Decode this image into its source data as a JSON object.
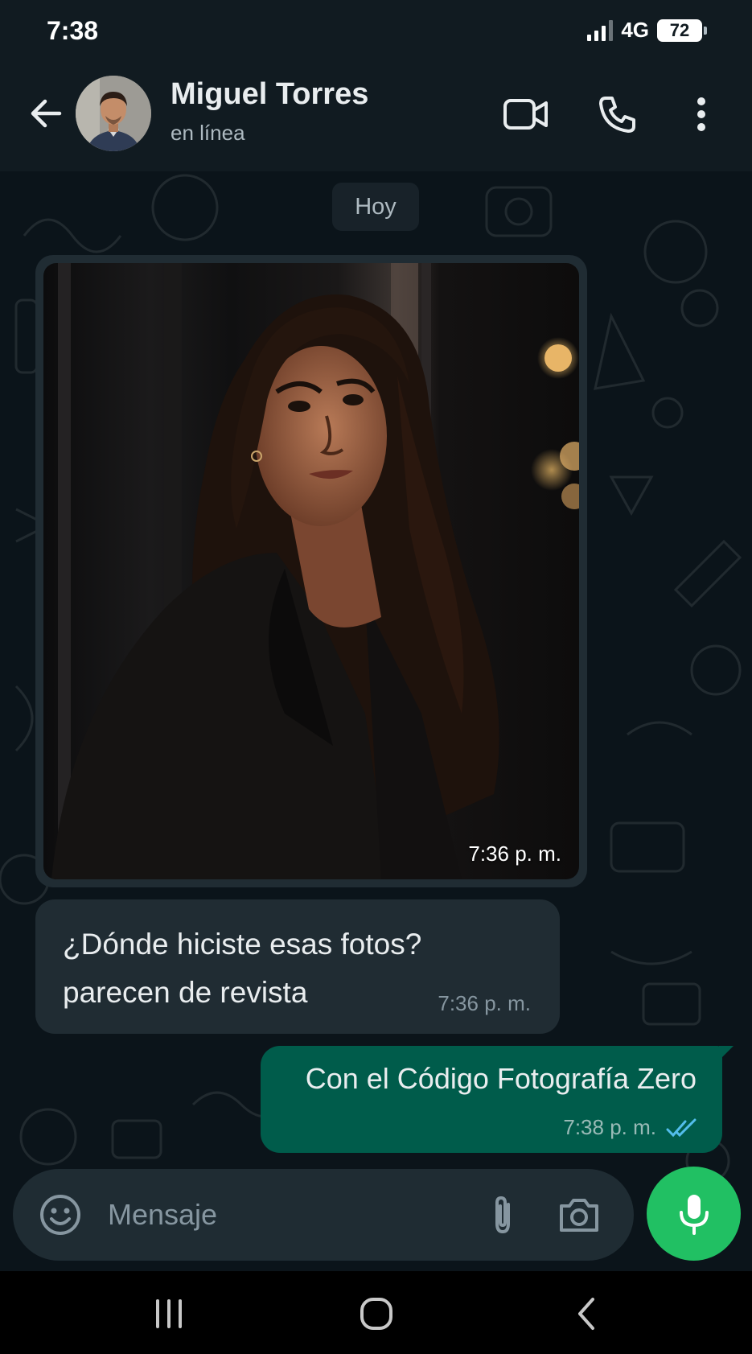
{
  "status_bar": {
    "time": "7:38",
    "network": "4G",
    "battery": "72"
  },
  "header": {
    "contact_name": "Miguel Torres",
    "contact_status": "en línea",
    "icons": [
      "back-arrow-icon",
      "avatar",
      "video-call-icon",
      "voice-call-icon",
      "more-options-icon"
    ]
  },
  "chat": {
    "date_chip": "Hoy",
    "messages": [
      {
        "type": "image",
        "direction": "incoming",
        "time": "7:36 p. m."
      },
      {
        "type": "text",
        "direction": "incoming",
        "text": "¿Dónde hiciste esas fotos?\nparecen de revista",
        "time": "7:36 p. m."
      },
      {
        "type": "text",
        "direction": "outgoing",
        "text": "Con el Código Fotografía Zero",
        "time": "7:38 p. m.",
        "status": "read"
      }
    ]
  },
  "composer": {
    "placeholder": "Mensaje",
    "icons": [
      "emoji-icon",
      "attach-icon",
      "camera-icon",
      "mic-icon"
    ]
  },
  "nav_bar": {
    "icons": [
      "recents-icon",
      "home-icon",
      "back-icon"
    ]
  },
  "colors": {
    "background": "#0b141a",
    "header": "#111b21",
    "incoming_bubble": "#202c33",
    "outgoing_bubble": "#005c4b",
    "accent_green": "#21c063",
    "read_ticks": "#53bdeb"
  }
}
